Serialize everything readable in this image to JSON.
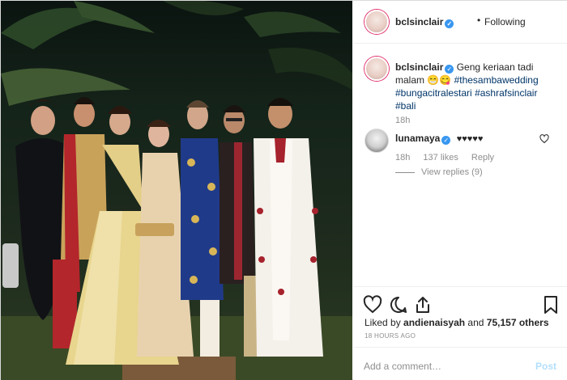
{
  "post": {
    "author": "bclsinclair",
    "follow_separator": "•",
    "follow_state": "Following",
    "caption_text": "Geng keriaan tadi malam 😁😋",
    "hashtags": [
      "#thesambawedding",
      "#bungacitralestari",
      "#ashrafsinclair",
      "#bali"
    ],
    "caption_time": "18h"
  },
  "comment": {
    "author": "lunamaya",
    "text": "♥♥♥♥♥",
    "time": "18h",
    "likes": "137 likes",
    "reply": "Reply",
    "view_replies": "View replies (9)"
  },
  "likes": {
    "prefix": "Liked by",
    "user": "andienaisyah",
    "and": "and",
    "others": "75,157 others"
  },
  "posted_ago": "18 HOURS AGO",
  "add_comment": {
    "placeholder": "Add a comment…",
    "post_label": "Post"
  },
  "icons": {
    "verified": "verified-badge-icon",
    "like": "heart-icon",
    "comment": "comment-icon",
    "share": "share-icon",
    "save": "bookmark-icon"
  },
  "colors": {
    "link": "#003569",
    "verified": "#3897f0",
    "muted": "#8e8e8e",
    "post_button": "#b2dffc"
  }
}
